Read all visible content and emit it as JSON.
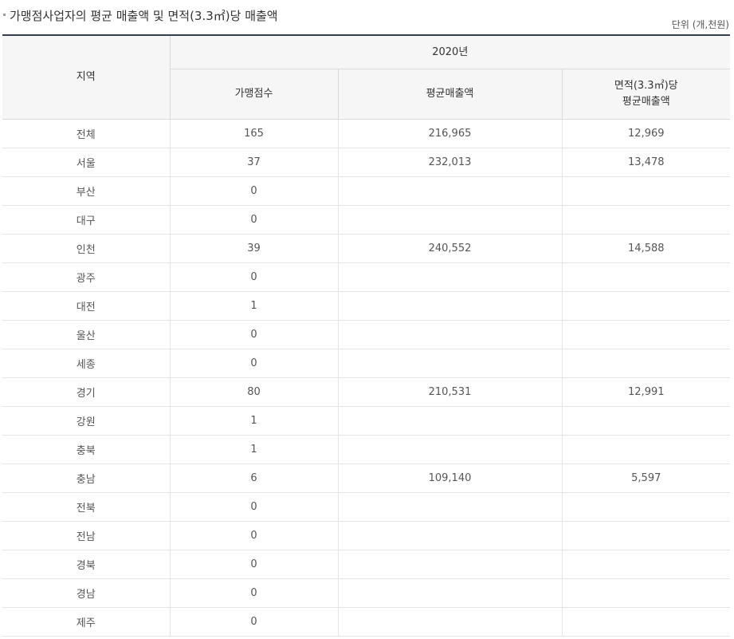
{
  "header": {
    "title": "가맹점사업자의 평균 매출액 및 면적(3.3㎡)당 매출액",
    "unit": "단위 (개,천원)"
  },
  "table": {
    "col_region": "지역",
    "col_year": "2020년",
    "col_stores": "가맹점수",
    "col_avg_sales": "평균매출액",
    "col_area_sales_line1": "면적(3.3㎡)당",
    "col_area_sales_line2": "평균매출액",
    "rows": [
      {
        "region": "전체",
        "stores": "165",
        "avg_sales": "216,965",
        "area_sales": "12,969"
      },
      {
        "region": "서울",
        "stores": "37",
        "avg_sales": "232,013",
        "area_sales": "13,478"
      },
      {
        "region": "부산",
        "stores": "0",
        "avg_sales": "",
        "area_sales": ""
      },
      {
        "region": "대구",
        "stores": "0",
        "avg_sales": "",
        "area_sales": ""
      },
      {
        "region": "인천",
        "stores": "39",
        "avg_sales": "240,552",
        "area_sales": "14,588"
      },
      {
        "region": "광주",
        "stores": "0",
        "avg_sales": "",
        "area_sales": ""
      },
      {
        "region": "대전",
        "stores": "1",
        "avg_sales": "",
        "area_sales": ""
      },
      {
        "region": "울산",
        "stores": "0",
        "avg_sales": "",
        "area_sales": ""
      },
      {
        "region": "세종",
        "stores": "0",
        "avg_sales": "",
        "area_sales": ""
      },
      {
        "region": "경기",
        "stores": "80",
        "avg_sales": "210,531",
        "area_sales": "12,991"
      },
      {
        "region": "강원",
        "stores": "1",
        "avg_sales": "",
        "area_sales": ""
      },
      {
        "region": "충북",
        "stores": "1",
        "avg_sales": "",
        "area_sales": ""
      },
      {
        "region": "충남",
        "stores": "6",
        "avg_sales": "109,140",
        "area_sales": "5,597"
      },
      {
        "region": "전북",
        "stores": "0",
        "avg_sales": "",
        "area_sales": ""
      },
      {
        "region": "전남",
        "stores": "0",
        "avg_sales": "",
        "area_sales": ""
      },
      {
        "region": "경북",
        "stores": "0",
        "avg_sales": "",
        "area_sales": ""
      },
      {
        "region": "경남",
        "stores": "0",
        "avg_sales": "",
        "area_sales": ""
      },
      {
        "region": "제주",
        "stores": "0",
        "avg_sales": "",
        "area_sales": ""
      }
    ]
  }
}
